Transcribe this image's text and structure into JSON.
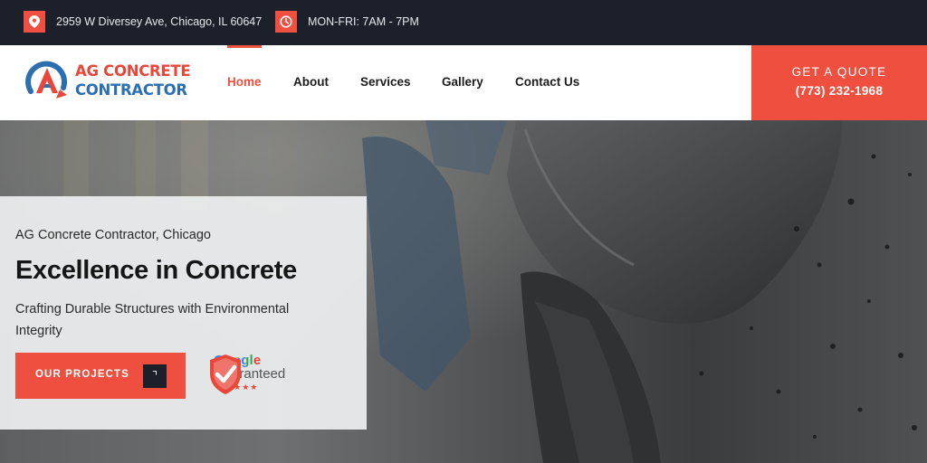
{
  "topbar": {
    "address": "2959 W Diversey Ave, Chicago, IL 60647",
    "hours": "MON-FRI: 7AM - 7PM",
    "icons": [
      "map-pin-icon",
      "clock-icon"
    ]
  },
  "header": {
    "logo": {
      "line1": "AG CONCRETE",
      "line2": "CONTRACTOR"
    },
    "nav": [
      {
        "label": "Home",
        "active": true
      },
      {
        "label": "About"
      },
      {
        "label": "Services"
      },
      {
        "label": "Gallery"
      },
      {
        "label": "Contact Us"
      }
    ],
    "quote": {
      "label": "GET A QUOTE",
      "phone": "(773) 232-1968"
    }
  },
  "hero": {
    "kicker": "AG Concrete Contractor, Chicago",
    "title": "Excellence in Concrete",
    "subtitle": "Crafting Durable Structures with Environmental Integrity",
    "button_label": "OUR PROJECTS",
    "button_icon": "⌝",
    "badge": {
      "brand": "Google",
      "label": "Guaranteed",
      "stars": "★★★★★"
    }
  },
  "colors": {
    "accent": "#ef4f3f",
    "dark": "#1b202b",
    "logo_blue": "#2c6fb0"
  }
}
